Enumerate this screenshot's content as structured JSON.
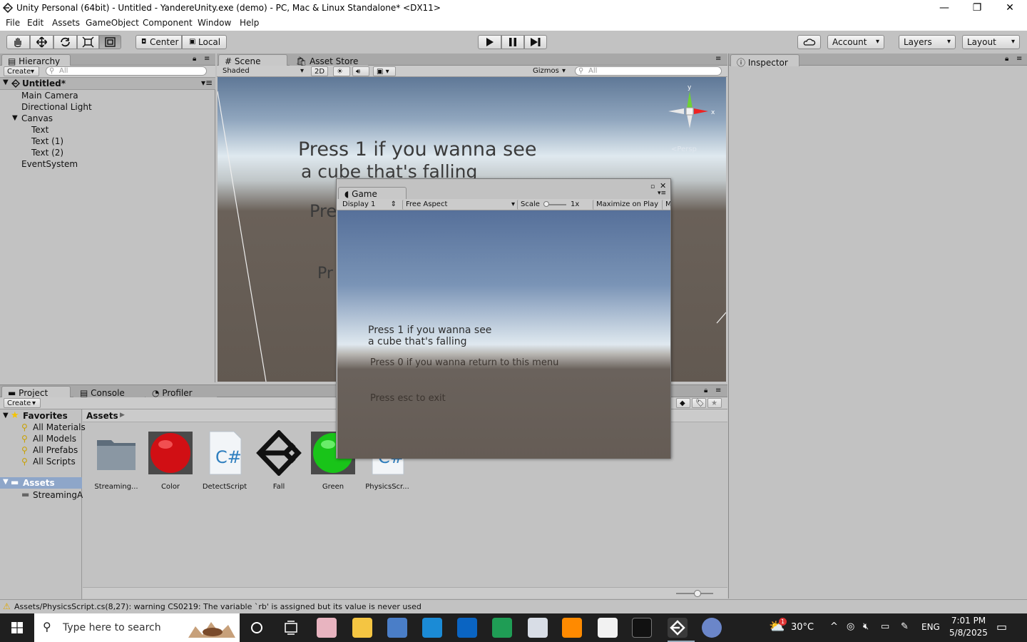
{
  "window": {
    "title": "Unity Personal (64bit) - Untitled - YandereUnity.exe (demo) - PC, Mac & Linux Standalone* <DX11>",
    "minimize_icon": "minimize-icon",
    "restore_icon": "restore-icon",
    "close_icon": "close-icon"
  },
  "menu": [
    "File",
    "Edit",
    "Assets",
    "GameObject",
    "Component",
    "Window",
    "Help"
  ],
  "toolbar": {
    "center": "Center",
    "local": "Local",
    "account": "Account",
    "layers": "Layers",
    "layout": "Layout",
    "tools": [
      "hand-tool-icon",
      "move-tool-icon",
      "rotate-tool-icon",
      "scale-tool-icon",
      "rect-tool-icon"
    ],
    "play_icons": [
      "play-icon",
      "pause-icon",
      "step-icon"
    ]
  },
  "hierarchy": {
    "tab": "Hierarchy",
    "create": "Create",
    "search_placeholder": "All",
    "scene": "Untitled*",
    "items": [
      "Main Camera",
      "Directional Light",
      "Canvas",
      "Text",
      "Text (1)",
      "Text (2)",
      "EventSystem"
    ]
  },
  "scene": {
    "tab": "Scene",
    "asset_store_tab": "Asset Store",
    "shading": "Shaded",
    "mode_2d": "2D",
    "gizmos": "Gizmos",
    "search_placeholder": "All",
    "persp": "Persp",
    "gizmo_y": "y",
    "gizmo_x": "x",
    "text1_line1": "Press 1 if you wanna see",
    "text1_line2": "a cube that's falling",
    "text2": "Pre",
    "text3": "Pr"
  },
  "game": {
    "tab": "Game",
    "display": "Display 1",
    "aspect": "Free Aspect",
    "scale_label": "Scale",
    "scale_value": "1x",
    "maximize": "Maximize on Play",
    "more": "M",
    "text1_line1": "Press 1 if you wanna see",
    "text1_line2": "a cube that's falling",
    "text2": "Press 0 if you wanna return to this menu",
    "text3": "Press esc to exit"
  },
  "inspector": {
    "tab": "Inspector"
  },
  "project": {
    "tab": "Project",
    "console_tab": "Console",
    "profiler_tab": "Profiler",
    "create": "Create",
    "favorites": "Favorites",
    "fav_items": [
      "All Materials",
      "All Models",
      "All Prefabs",
      "All Scripts"
    ],
    "assets": "Assets",
    "asset_children": [
      "StreamingA"
    ],
    "breadcrumb": "Assets",
    "grid": [
      {
        "name": "Streaming...",
        "icon": "folder-icon"
      },
      {
        "name": "Color",
        "icon": "material-sphere-icon"
      },
      {
        "name": "DetectScript",
        "icon": "csharp-script-icon"
      },
      {
        "name": "Fall",
        "icon": "unity-logo-icon"
      },
      {
        "name": "Green",
        "icon": "material-sphere-icon"
      },
      {
        "name": "PhysicsScr...",
        "icon": "csharp-script-icon"
      }
    ],
    "colors": {
      "red": "#d10f14",
      "green": "#19c419"
    }
  },
  "status": {
    "message": "Assets/PhysicsScript.cs(8,27): warning CS0219: The variable `rb' is assigned but its value is never used"
  },
  "taskbar": {
    "search_placeholder": "Type here to search",
    "weather": "30°C",
    "lang": "ENG",
    "time": "7:01 PM",
    "date": "5/8/2025",
    "badge": "1"
  }
}
